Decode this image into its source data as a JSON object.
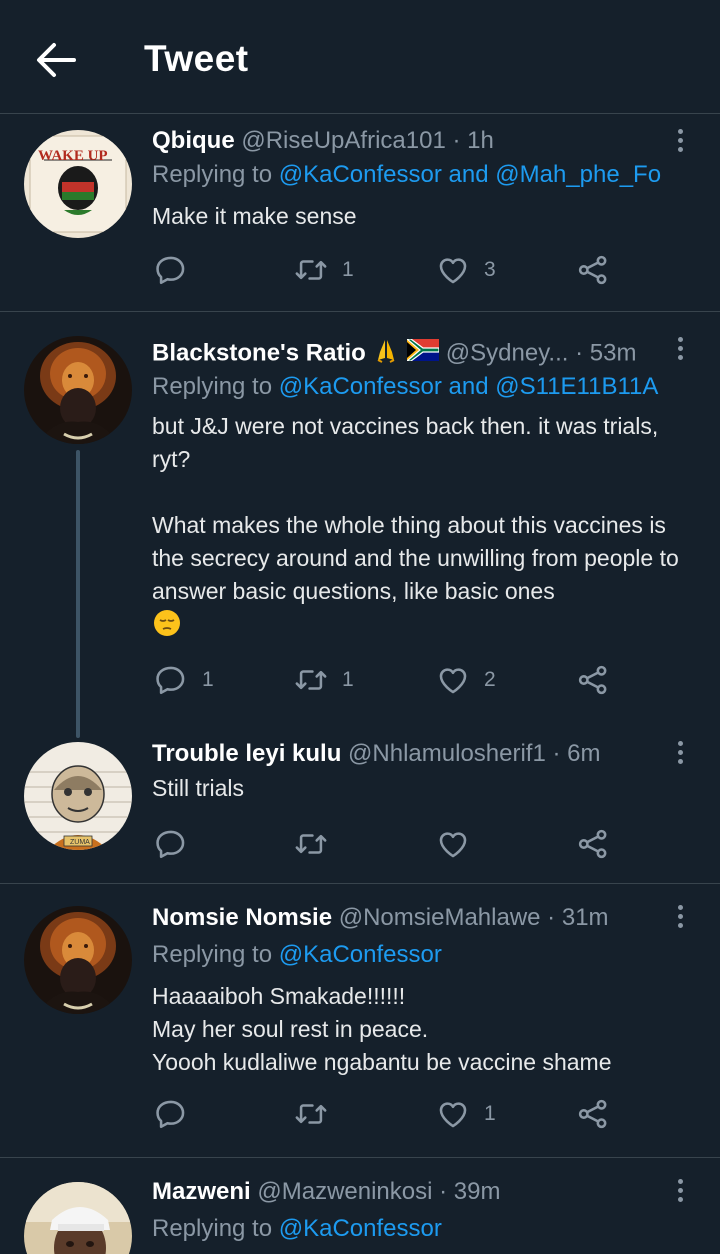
{
  "header": {
    "title": "Tweet",
    "back_icon": "arrow-left-icon"
  },
  "tweets": [
    {
      "name": "Qbique",
      "handle": "@RiseUpAfrica101",
      "dot": "·",
      "time": "1h",
      "reply_prefix": "Replying to",
      "mentions": [
        "@KaConfessor",
        "@Mah_phe_Fo"
      ],
      "mention_joiner": "and",
      "body": [
        "Make it make sense"
      ],
      "reply_count": "",
      "retweet_count": "1",
      "like_count": "3",
      "avatar_text": "WAKE UP"
    },
    {
      "name": "Blackstone's Ratio",
      "name_emojis": [
        "folded-hands-emoji",
        "south-africa-flag-emoji"
      ],
      "handle": "@Sydney...",
      "dot": "·",
      "time": "53m",
      "reply_prefix": "Replying to",
      "mentions": [
        "@KaConfessor",
        "@S11E11B11A"
      ],
      "mention_joiner": "and",
      "body": [
        "but J&J were not vaccines back then. it was trials, ryt?",
        "",
        "What makes the whole thing about this vaccines is the secrecy around and the unwilling from people to answer basic questions, like basic ones"
      ],
      "body_emoji": "pensive-face-emoji",
      "reply_count": "1",
      "retweet_count": "1",
      "like_count": "2"
    },
    {
      "name": "Trouble leyi kulu",
      "handle": "@Nhlamulosherif1",
      "dot": "·",
      "time": "6m",
      "body": [
        "Still trials"
      ],
      "reply_count": "",
      "retweet_count": "",
      "like_count": "",
      "avatar_text": "ZUMA"
    },
    {
      "name": "Nomsie Nomsie",
      "handle": "@NomsieMahlawe",
      "dot": "·",
      "time": "31m",
      "reply_prefix": "Replying to",
      "mentions": [
        "@KaConfessor"
      ],
      "body": [
        "Haaaaiboh Smakade!!!!!!",
        "May her soul rest in peace.",
        "Yoooh kudlaliwe ngabantu be vaccine shame"
      ],
      "reply_count": "",
      "retweet_count": "",
      "like_count": "1"
    },
    {
      "name": "Mazweni",
      "handle": "@Mazweninkosi",
      "dot": "·",
      "time": "39m",
      "reply_prefix": "Replying to",
      "mentions": [
        "@KaConfessor"
      ]
    }
  ],
  "icons": {
    "reply": "reply-bubble-icon",
    "retweet": "retweet-icon",
    "like": "heart-icon",
    "share": "share-icon",
    "more": "more-vertical-icon"
  },
  "colors": {
    "background": "#15202b",
    "divider": "#38444d",
    "secondary_text": "#8b98a5",
    "link": "#1d9bf0"
  }
}
